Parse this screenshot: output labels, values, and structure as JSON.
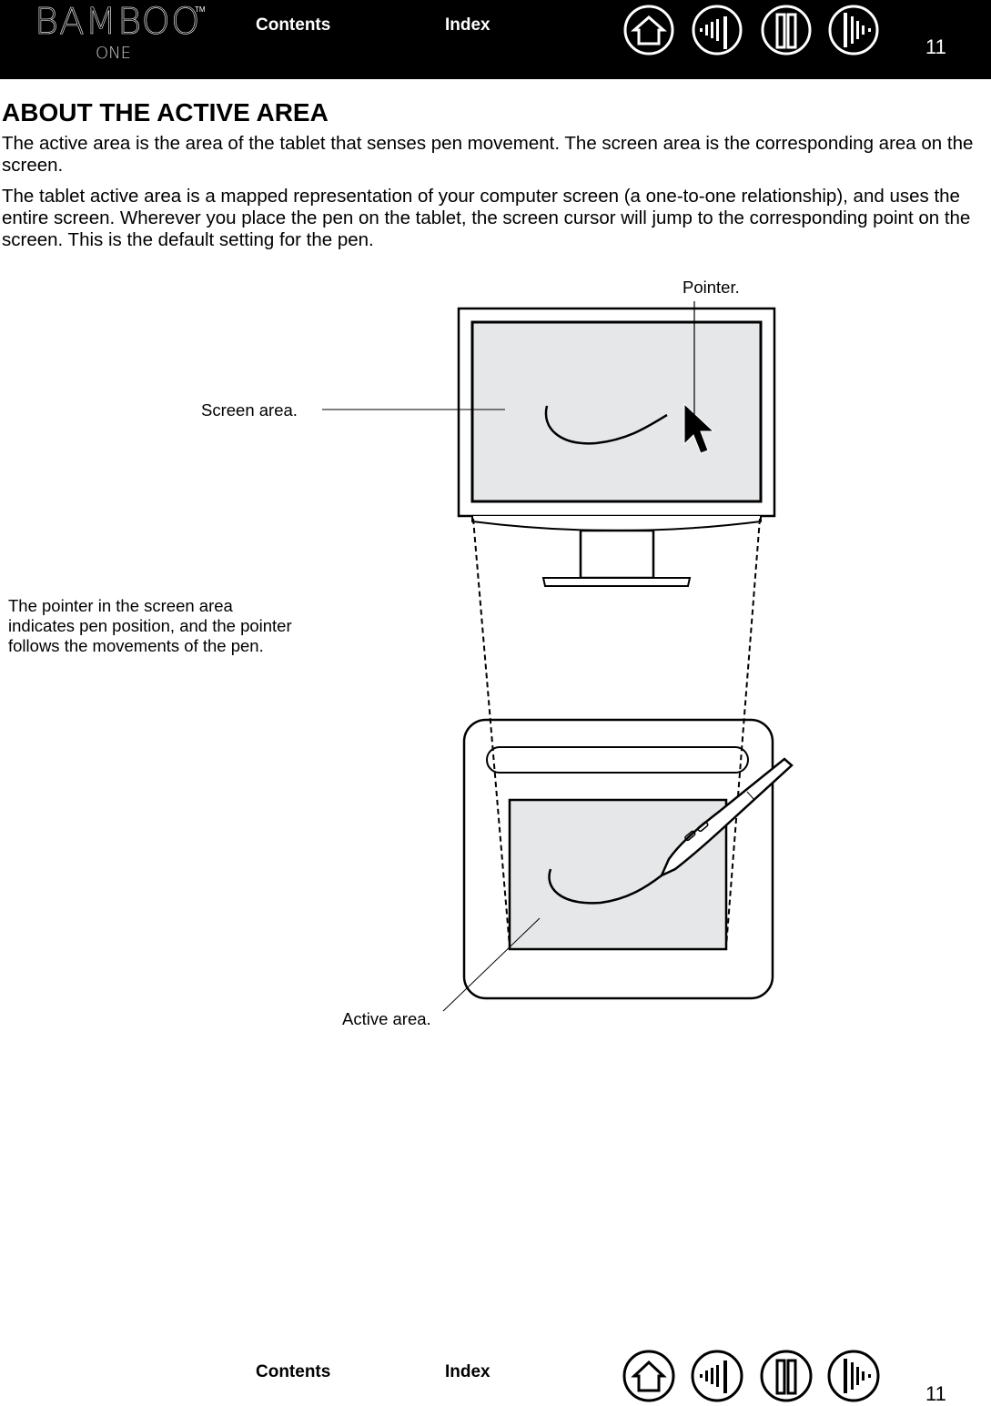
{
  "header": {
    "logo_text": "BAMBOO",
    "logo_tm": "TM",
    "logo_sub": "ONE",
    "contents_label": "Contents",
    "index_label": "Index",
    "page_number": "11",
    "nav_icons": [
      "home-icon",
      "previous-chapter-icon",
      "toc-page-icon",
      "next-chapter-icon"
    ]
  },
  "section": {
    "title": "ABOUT THE ACTIVE AREA",
    "paragraphs": [
      "The active area is the area of the tablet that senses pen movement.  The screen area is the corresponding area on the screen.",
      "The tablet active area is a mapped representation of your computer screen (a one-to-one relationship), and uses the entire screen.  Wherever you place the pen on the tablet, the screen cursor will jump to the corresponding point on the screen.  This is the default setting for the pen."
    ]
  },
  "figure": {
    "labels": {
      "pointer": "Pointer.",
      "screen_area": "Screen area.",
      "active_area": "Active area."
    },
    "caption": "The pointer in the screen area indicates pen position, and the pointer follows the movements of the pen.",
    "colors": {
      "area_fill": "#e6e7e8",
      "stroke": "#000000"
    }
  },
  "footer": {
    "contents_label": "Contents",
    "index_label": "Index",
    "page_number": "11"
  }
}
